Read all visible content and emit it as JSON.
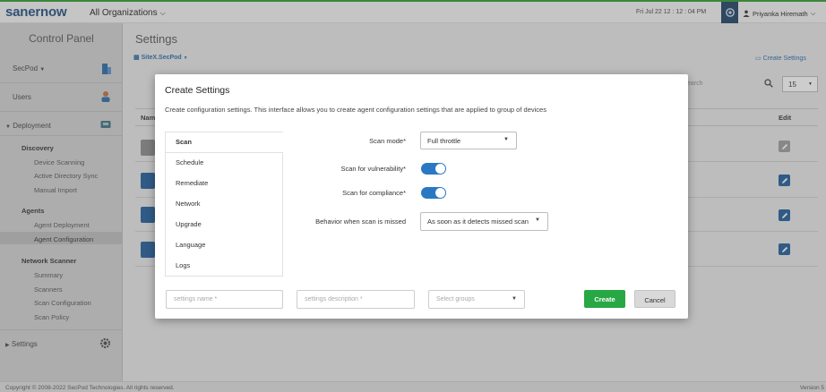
{
  "topbar": {
    "logo_saner": "saner",
    "logo_now": "now",
    "org": "All Organizations",
    "datetime": "Fri Jul 22  12 : 12 : 04 PM",
    "user": "Priyanka Hiremath"
  },
  "sidebar": {
    "title": "Control Panel",
    "secpod": "SecPod",
    "users": "Users",
    "deployment": "Deployment",
    "discovery": "Discovery",
    "device_scanning": "Device Scanning",
    "active_directory_sync": "Active Directory Sync",
    "manual_import": "Manual Import",
    "agents": "Agents",
    "agent_deployment": "Agent Deployment",
    "agent_configuration": "Agent Configuration",
    "network_scanner": "Network Scanner",
    "summary": "Summary",
    "scanners": "Scanners",
    "scan_configuration": "Scan Configuration",
    "scan_policy": "Scan Policy",
    "settings": "Settings"
  },
  "main": {
    "title": "Settings",
    "site": "SiteX.SecPod",
    "create_settings_link": "Create Settings",
    "search_fragment": "earch",
    "per_page": "15",
    "col_name_fragment": "Nam",
    "col_edit": "Edit"
  },
  "modal": {
    "title": "Create Settings",
    "description": "Create configuration settings. This interface allows you to create agent configuration settings that are applied to group of devices",
    "tabs": [
      "Scan",
      "Schedule",
      "Remediate",
      "Network",
      "Upgrade",
      "Language",
      "Logs"
    ],
    "scan_mode_label": "Scan mode*",
    "scan_mode_value": "Full throttle",
    "scan_vuln_label": "Scan for vulnerability*",
    "scan_vuln_on": true,
    "scan_compliance_label": "Scan for compliance*",
    "scan_compliance_on": true,
    "missed_label": "Behavior when scan is missed",
    "missed_value": "As soon as it detects missed scan",
    "settings_name_placeholder": "settings name *",
    "settings_description_placeholder": "settings description *",
    "select_groups_placeholder": "Select groups",
    "create_label": "Create",
    "cancel_label": "Cancel"
  },
  "footer": {
    "copyright": "Copyright © 2008-2022 SecPod Technologies. All rights reserved.",
    "version": "Version 5"
  },
  "colors": {
    "accent_green": "#28a745",
    "brand_blue": "#1f4f7f",
    "toggle_blue": "#2a78c2"
  }
}
